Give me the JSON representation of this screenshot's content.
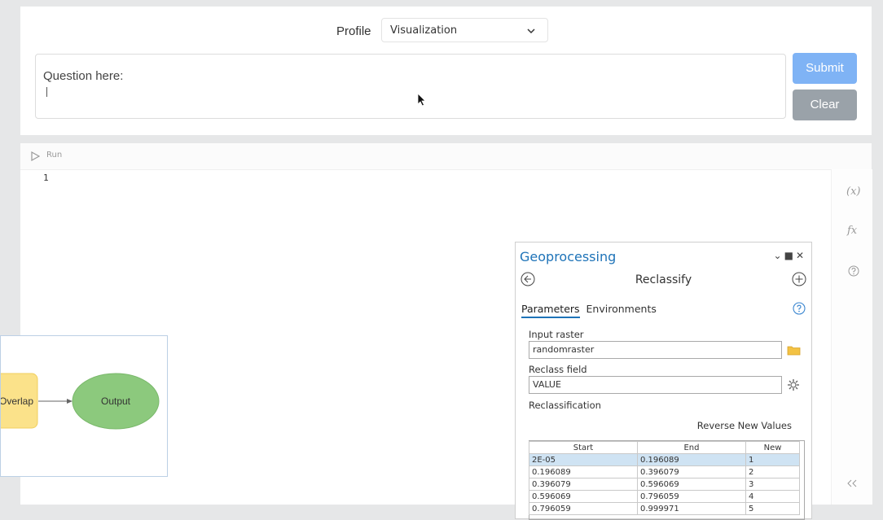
{
  "profile": {
    "label": "Profile",
    "selected": "Visualization"
  },
  "question": {
    "label": "Question here:",
    "value": ""
  },
  "buttons": {
    "submit": "Submit",
    "clear": "Clear"
  },
  "editor": {
    "run_label": "Run",
    "line_number": "1"
  },
  "side_icons": {
    "variables": "(x)",
    "functions": "fx"
  },
  "model": {
    "node_left": "Overlap",
    "node_right": "Output"
  },
  "geoprocessing": {
    "title": "Geoprocessing",
    "tool": "Reclassify",
    "tabs": {
      "parameters": "Parameters",
      "environments": "Environments"
    },
    "input_raster_label": "Input raster",
    "input_raster_value": "randomraster",
    "reclass_field_label": "Reclass field",
    "reclass_field_value": "VALUE",
    "reclassification_label": "Reclassification",
    "reverse_label": "Reverse New Values",
    "table": {
      "headers": [
        "Start",
        "End",
        "New"
      ],
      "rows": [
        [
          "2E-05",
          "0.196089",
          "1"
        ],
        [
          "0.196089",
          "0.396079",
          "2"
        ],
        [
          "0.396079",
          "0.596069",
          "3"
        ],
        [
          "0.596069",
          "0.796059",
          "4"
        ],
        [
          "0.796059",
          "0.999971",
          "5"
        ]
      ]
    }
  },
  "colors": {
    "submit": "#7fb3f5",
    "clear": "#9aa2a9",
    "geo_title": "#1e73b8",
    "node_yellow": "#fbe28a",
    "node_green": "#8cc97d",
    "row_selected": "#cfe3f3"
  }
}
